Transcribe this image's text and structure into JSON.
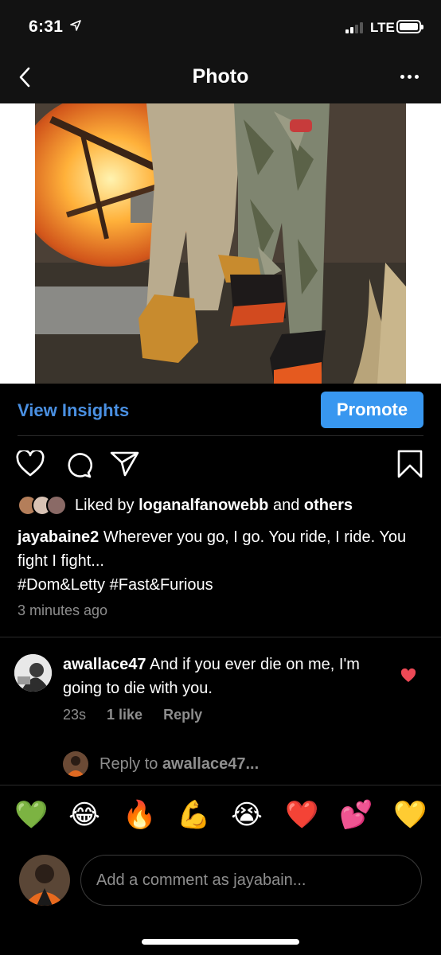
{
  "status": {
    "time": "6:31",
    "network": "LTE",
    "icons": [
      "location-arrow-icon",
      "signal-icon",
      "battery-icon"
    ]
  },
  "nav": {
    "title": "Photo",
    "back_icon": "chevron-left-icon",
    "more_icon": "more-dots-icon"
  },
  "post_actions": {
    "insights_label": "View Insights",
    "promote_label": "Promote",
    "icons": [
      "heart-icon",
      "comment-icon",
      "share-icon",
      "bookmark-icon"
    ]
  },
  "likes": {
    "prefix": "Liked by",
    "user": "loganalfanowebb",
    "joiner": "and",
    "others": "others"
  },
  "caption": {
    "username": "jayabaine2",
    "text": "Wherever you go, I go. You ride, I ride. You fight I fight...",
    "hashtags": "#Dom&Letty #Fast&Furious",
    "time_ago": "3 minutes ago"
  },
  "comment": {
    "username": "awallace47",
    "text": "And if you ever die on me, I'm going to die with you.",
    "age": "23s",
    "likes": "1 like",
    "reply_label": "Reply",
    "liked": true
  },
  "reply_prompt": {
    "prefix": "Reply to",
    "username": "awallace47..."
  },
  "emoji_bar": [
    "💚",
    "😂",
    "🔥",
    "💪",
    "😭",
    "❤️",
    "💕",
    "💛"
  ],
  "comment_input": {
    "placeholder": "Add a comment as jayabain..."
  },
  "colors": {
    "accent_blue": "#3897f0",
    "link_blue": "#4a90e2",
    "heart_red": "#ed4956",
    "muted": "#8e8e8e"
  }
}
